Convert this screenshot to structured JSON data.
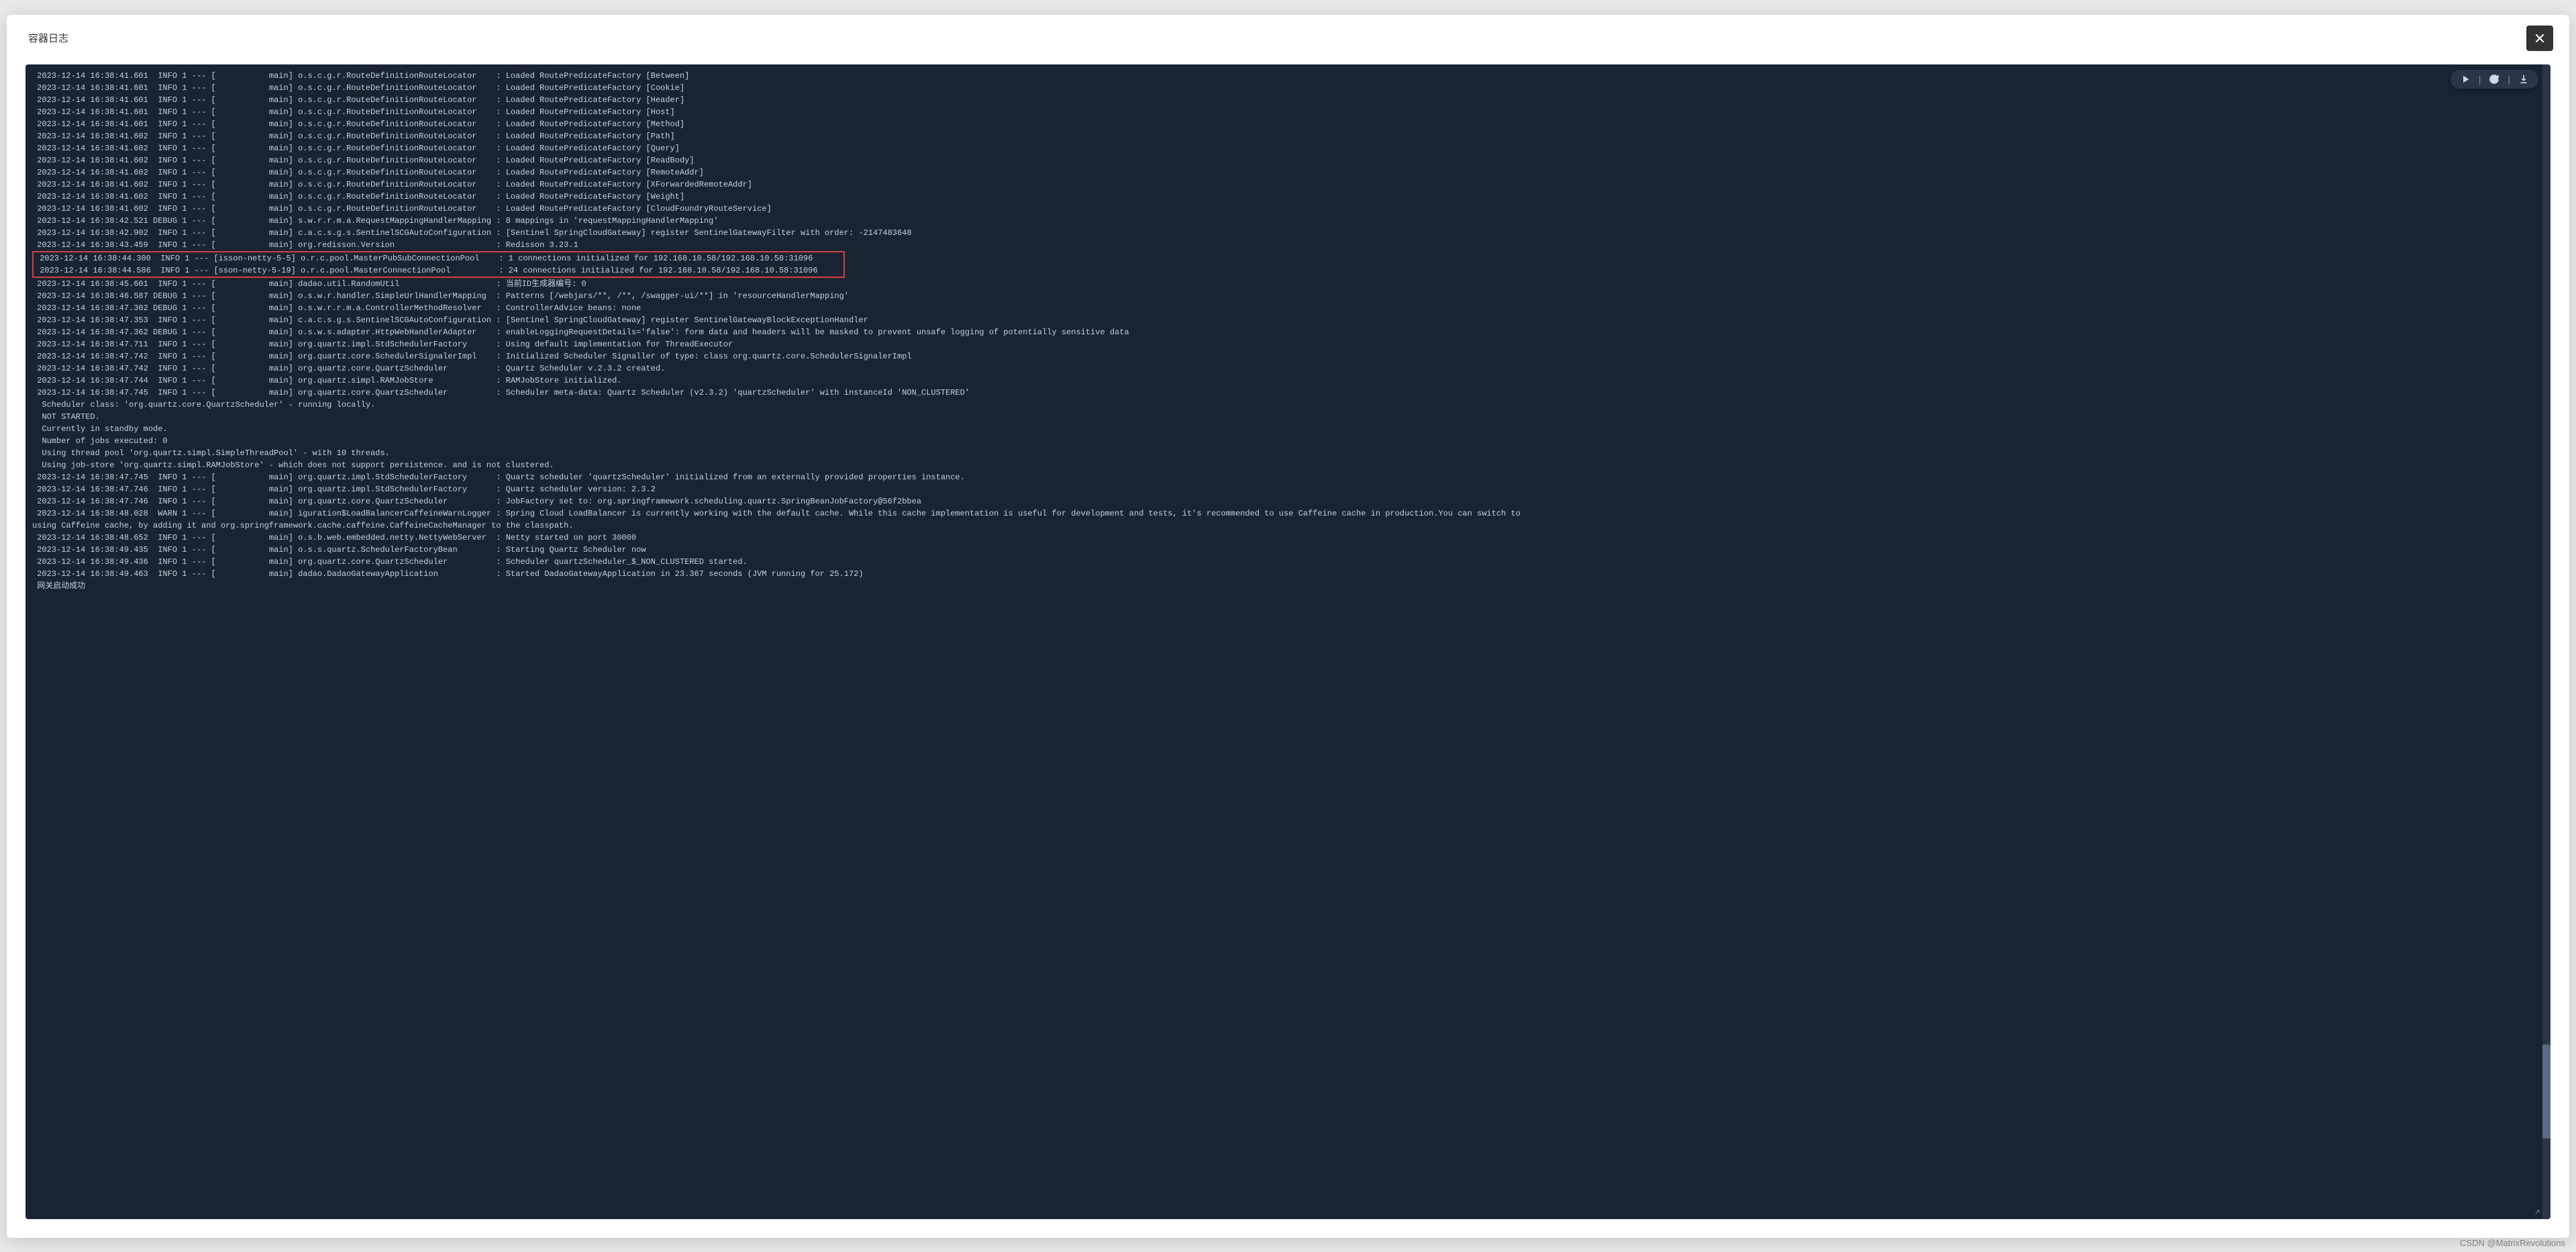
{
  "modal": {
    "title": "容器日志"
  },
  "toolbar": {
    "play_icon": "play",
    "pause_icon": "pause",
    "refresh_icon": "refresh",
    "download_icon": "download"
  },
  "watermark": "CSDN @MatrixRevolutions",
  "resize_marker": "↗",
  "log_lines": [
    " 2023-12-14 16:38:41.601  INFO 1 --- [           main] o.s.c.g.r.RouteDefinitionRouteLocator    : Loaded RoutePredicateFactory [Between]",
    " 2023-12-14 16:38:41.601  INFO 1 --- [           main] o.s.c.g.r.RouteDefinitionRouteLocator    : Loaded RoutePredicateFactory [Cookie]",
    " 2023-12-14 16:38:41.601  INFO 1 --- [           main] o.s.c.g.r.RouteDefinitionRouteLocator    : Loaded RoutePredicateFactory [Header]",
    " 2023-12-14 16:38:41.601  INFO 1 --- [           main] o.s.c.g.r.RouteDefinitionRouteLocator    : Loaded RoutePredicateFactory [Host]",
    " 2023-12-14 16:38:41.601  INFO 1 --- [           main] o.s.c.g.r.RouteDefinitionRouteLocator    : Loaded RoutePredicateFactory [Method]",
    " 2023-12-14 16:38:41.602  INFO 1 --- [           main] o.s.c.g.r.RouteDefinitionRouteLocator    : Loaded RoutePredicateFactory [Path]",
    " 2023-12-14 16:38:41.602  INFO 1 --- [           main] o.s.c.g.r.RouteDefinitionRouteLocator    : Loaded RoutePredicateFactory [Query]",
    " 2023-12-14 16:38:41.602  INFO 1 --- [           main] o.s.c.g.r.RouteDefinitionRouteLocator    : Loaded RoutePredicateFactory [ReadBody]",
    " 2023-12-14 16:38:41.602  INFO 1 --- [           main] o.s.c.g.r.RouteDefinitionRouteLocator    : Loaded RoutePredicateFactory [RemoteAddr]",
    " 2023-12-14 16:38:41.602  INFO 1 --- [           main] o.s.c.g.r.RouteDefinitionRouteLocator    : Loaded RoutePredicateFactory [XForwardedRemoteAddr]",
    " 2023-12-14 16:38:41.602  INFO 1 --- [           main] o.s.c.g.r.RouteDefinitionRouteLocator    : Loaded RoutePredicateFactory [Weight]",
    " 2023-12-14 16:38:41.602  INFO 1 --- [           main] o.s.c.g.r.RouteDefinitionRouteLocator    : Loaded RoutePredicateFactory [CloudFoundryRouteService]",
    " 2023-12-14 16:38:42.521 DEBUG 1 --- [           main] s.w.r.r.m.a.RequestMappingHandlerMapping : 8 mappings in 'requestMappingHandlerMapping'",
    " 2023-12-14 16:38:42.902  INFO 1 --- [           main] c.a.c.s.g.s.SentinelSCGAutoConfiguration : [Sentinel SpringCloudGateway] register SentinelGatewayFilter with order: -2147483648",
    " 2023-12-14 16:38:43.459  INFO 1 --- [           main] org.redisson.Version                     : Redisson 3.23.1"
  ],
  "highlighted_lines": [
    " 2023-12-14 16:38:44.300  INFO 1 --- [isson-netty-5-5] o.r.c.pool.MasterPubSubConnectionPool    : 1 connections initialized for 192.168.10.58/192.168.10.58:31096   ",
    " 2023-12-14 16:38:44.586  INFO 1 --- [sson-netty-5-19] o.r.c.pool.MasterConnectionPool          : 24 connections initialized for 192.168.10.58/192.168.10.58:31096     "
  ],
  "log_lines_after": [
    " 2023-12-14 16:38:45.601  INFO 1 --- [           main] dadao.util.RandomUtil                    : 当前ID生成器编号: 0",
    " 2023-12-14 16:38:46.587 DEBUG 1 --- [           main] o.s.w.r.handler.SimpleUrlHandlerMapping  : Patterns [/webjars/**, /**, /swagger-ui/**] in 'resourceHandlerMapping'",
    " 2023-12-14 16:38:47.302 DEBUG 1 --- [           main] o.s.w.r.r.m.a.ControllerMethodResolver   : ControllerAdvice beans: none",
    " 2023-12-14 16:38:47.353  INFO 1 --- [           main] c.a.c.s.g.s.SentinelSCGAutoConfiguration : [Sentinel SpringCloudGateway] register SentinelGatewayBlockExceptionHandler",
    " 2023-12-14 16:38:47.362 DEBUG 1 --- [           main] o.s.w.s.adapter.HttpWebHandlerAdapter    : enableLoggingRequestDetails='false': form data and headers will be masked to prevent unsafe logging of potentially sensitive data",
    " 2023-12-14 16:38:47.711  INFO 1 --- [           main] org.quartz.impl.StdSchedulerFactory      : Using default implementation for ThreadExecutor",
    " 2023-12-14 16:38:47.742  INFO 1 --- [           main] org.quartz.core.SchedulerSignalerImpl    : Initialized Scheduler Signaller of type: class org.quartz.core.SchedulerSignalerImpl",
    " 2023-12-14 16:38:47.742  INFO 1 --- [           main] org.quartz.core.QuartzScheduler          : Quartz Scheduler v.2.3.2 created.",
    " 2023-12-14 16:38:47.744  INFO 1 --- [           main] org.quartz.simpl.RAMJobStore             : RAMJobStore initialized.",
    " 2023-12-14 16:38:47.745  INFO 1 --- [           main] org.quartz.core.QuartzScheduler          : Scheduler meta-data: Quartz Scheduler (v2.3.2) 'quartzScheduler' with instanceId 'NON_CLUSTERED'",
    "  Scheduler class: 'org.quartz.core.QuartzScheduler' - running locally.",
    "  NOT STARTED.",
    "  Currently in standby mode.",
    "  Number of jobs executed: 0",
    "  Using thread pool 'org.quartz.simpl.SimpleThreadPool' - with 10 threads.",
    "  Using job-store 'org.quartz.simpl.RAMJobStore' - which does not support persistence. and is not clustered.",
    "",
    " 2023-12-14 16:38:47.745  INFO 1 --- [           main] org.quartz.impl.StdSchedulerFactory      : Quartz scheduler 'quartzScheduler' initialized from an externally provided properties instance.",
    " 2023-12-14 16:38:47.746  INFO 1 --- [           main] org.quartz.impl.StdSchedulerFactory      : Quartz scheduler version: 2.3.2",
    " 2023-12-14 16:38:47.746  INFO 1 --- [           main] org.quartz.core.QuartzScheduler          : JobFactory set to: org.springframework.scheduling.quartz.SpringBeanJobFactory@56f2bbea",
    " 2023-12-14 16:38:48.028  WARN 1 --- [           main] iguration$LoadBalancerCaffeineWarnLogger : Spring Cloud LoadBalancer is currently working with the default cache. While this cache implementation is useful for development and tests, it's recommended to use Caffeine cache in production.You can switch to",
    "using Caffeine cache, by adding it and org.springframework.cache.caffeine.CaffeineCacheManager to the classpath.",
    " 2023-12-14 16:38:48.652  INFO 1 --- [           main] o.s.b.web.embedded.netty.NettyWebServer  : Netty started on port 30000",
    " 2023-12-14 16:38:49.435  INFO 1 --- [           main] o.s.s.quartz.SchedulerFactoryBean        : Starting Quartz Scheduler now",
    " 2023-12-14 16:38:49.436  INFO 1 --- [           main] org.quartz.core.QuartzScheduler          : Scheduler quartzScheduler_$_NON_CLUSTERED started.",
    " 2023-12-14 16:38:49.463  INFO 1 --- [           main] dadao.DadaoGatewayApplication            : Started DadaoGatewayApplication in 23.367 seconds (JVM running for 25.172)",
    " 网关启动成功"
  ]
}
